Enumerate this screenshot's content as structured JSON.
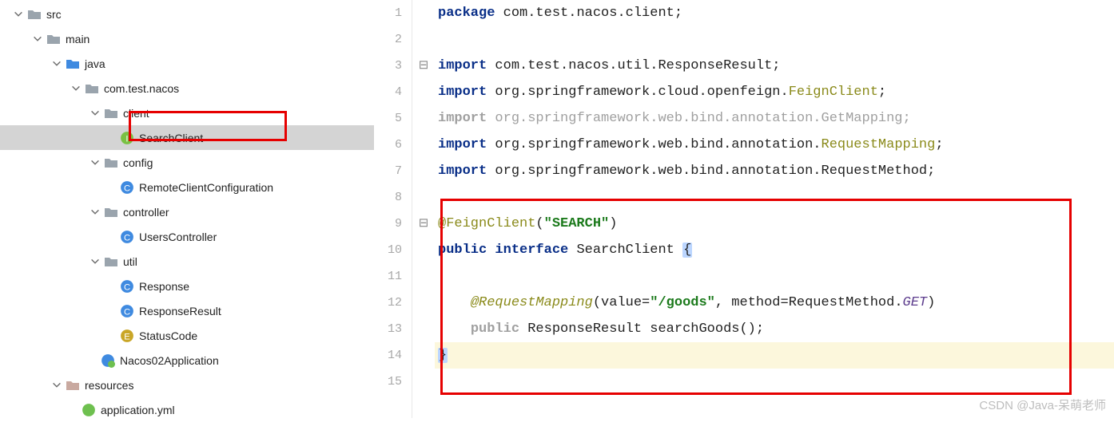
{
  "tree": {
    "src": "src",
    "main": "main",
    "java": "java",
    "pkg": "com.test.nacos",
    "client": "client",
    "search": "SearchClient",
    "config": "config",
    "remote": "RemoteClientConfiguration",
    "controller": "controller",
    "users": "UsersController",
    "util": "util",
    "response": "Response",
    "respres": "ResponseResult",
    "status": "StatusCode",
    "app": "Nacos02Application",
    "resources": "resources",
    "appyml": "application.yml"
  },
  "gutter": [
    "1",
    "2",
    "3",
    "4",
    "5",
    "6",
    "7",
    "8",
    "9",
    "10",
    "11",
    "12",
    "13",
    "14",
    "15"
  ],
  "code": {
    "pkg_kw": "package ",
    "pkg_val": "com.test.nacos.client;",
    "imp_kw": "import ",
    "imp1": "com.test.nacos.util.ResponseResult;",
    "imp2a": "org.springframework.cloud.openfeign.",
    "imp2b": "FeignClient",
    "imp2c": ";",
    "imp3": "org.springframework.web.bind.annotation.GetMapping;",
    "imp4a": "org.springframework.web.bind.annotation.",
    "imp4b": "RequestMapping",
    "imp4c": ";",
    "imp5": "org.springframework.web.bind.annotation.RequestMethod;",
    "ann_fc": "@FeignClient",
    "ann_fc_arg": "\"SEARCH\"",
    "pub": "public ",
    "iface": "interface ",
    "sc": "SearchClient ",
    "ann_rm": "@RequestMapping",
    "rm_val": "(value=",
    "rm_path": "\"/goods\"",
    "rm_meth": ", method=RequestMethod.",
    "rm_get": "GET",
    "rm_close": ")",
    "decl_ret": "ResponseResult ",
    "decl_name": "searchGoods();"
  },
  "watermark": "CSDN @Java-呆萌老师"
}
